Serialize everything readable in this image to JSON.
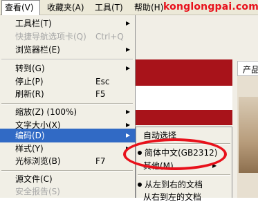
{
  "menubar": {
    "view": "查看(V)",
    "favorites": "收藏夹(A)",
    "tools": "工具(T)",
    "help": "帮助(H)",
    "watermark": "konglongpai.com"
  },
  "webpage": {
    "product_tab": "产品"
  },
  "view_menu": {
    "toolbar": "工具栏(T)",
    "quick_tabs": "快捷导航选项卡(Q)",
    "quick_tabs_shortcut": "Ctrl+Q",
    "explorer_bar": "浏览器栏(E)",
    "go_to": "转到(G)",
    "stop": "停止(P)",
    "stop_shortcut": "Esc",
    "refresh": "刷新(R)",
    "refresh_shortcut": "F5",
    "zoom": "缩放(Z) (100%)",
    "text_size": "文字大小(X)",
    "encoding": "编码(D)",
    "style": "样式(Y)",
    "caret_browsing": "光标浏览(B)",
    "caret_browsing_shortcut": "F7",
    "source": "源文件(C)",
    "security_report": "安全报告(S)"
  },
  "encoding_submenu": {
    "auto_select": "自动选择",
    "simplified_chinese": "简体中文(GB2312)",
    "more": "其他(M)",
    "ltr": "从左到右的文档",
    "rtl": "从右到左的文档"
  },
  "colors": {
    "selection": "#316ac5",
    "annotation": "#e8111b",
    "page_red": "#a8131a"
  }
}
